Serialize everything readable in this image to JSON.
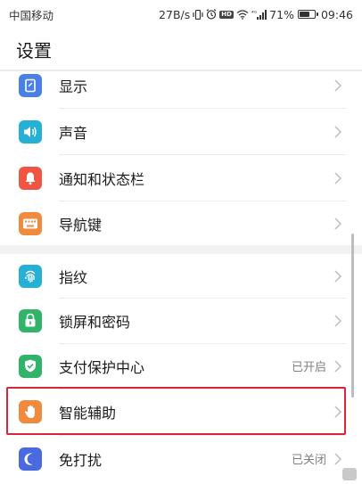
{
  "status_bar": {
    "carrier": "中国移动",
    "net_speed": "27B/s",
    "signal": "⁴ᴳ",
    "battery_percent": "71%",
    "battery_level": 71,
    "time": "09:46",
    "hd": "HD"
  },
  "header": {
    "title": "设置"
  },
  "settings": {
    "display": {
      "label": "显示",
      "icon": "display-icon",
      "color": "#4a7fe8"
    },
    "sound": {
      "label": "声音",
      "icon": "speaker-icon",
      "color": "#27b0d6"
    },
    "notification": {
      "label": "通知和状态栏",
      "icon": "bell-icon",
      "color": "#ef5541"
    },
    "navigation": {
      "label": "导航键",
      "icon": "keyboard-icon",
      "color": "#f08a3c"
    },
    "fingerprint": {
      "label": "指纹",
      "icon": "fingerprint-icon",
      "color": "#27b0d6"
    },
    "lockscreen": {
      "label": "锁屏和密码",
      "icon": "lock-icon",
      "color": "#32b36a"
    },
    "payment": {
      "label": "支付保护中心",
      "icon": "shield-check-icon",
      "color": "#32b36a",
      "status": "已开启"
    },
    "assist": {
      "label": "智能辅助",
      "icon": "hand-icon",
      "color": "#f08a3c"
    },
    "dnd": {
      "label": "免打扰",
      "icon": "moon-icon",
      "color": "#4a6be0",
      "status": "已关闭"
    }
  },
  "highlight_color": "#d9263a"
}
